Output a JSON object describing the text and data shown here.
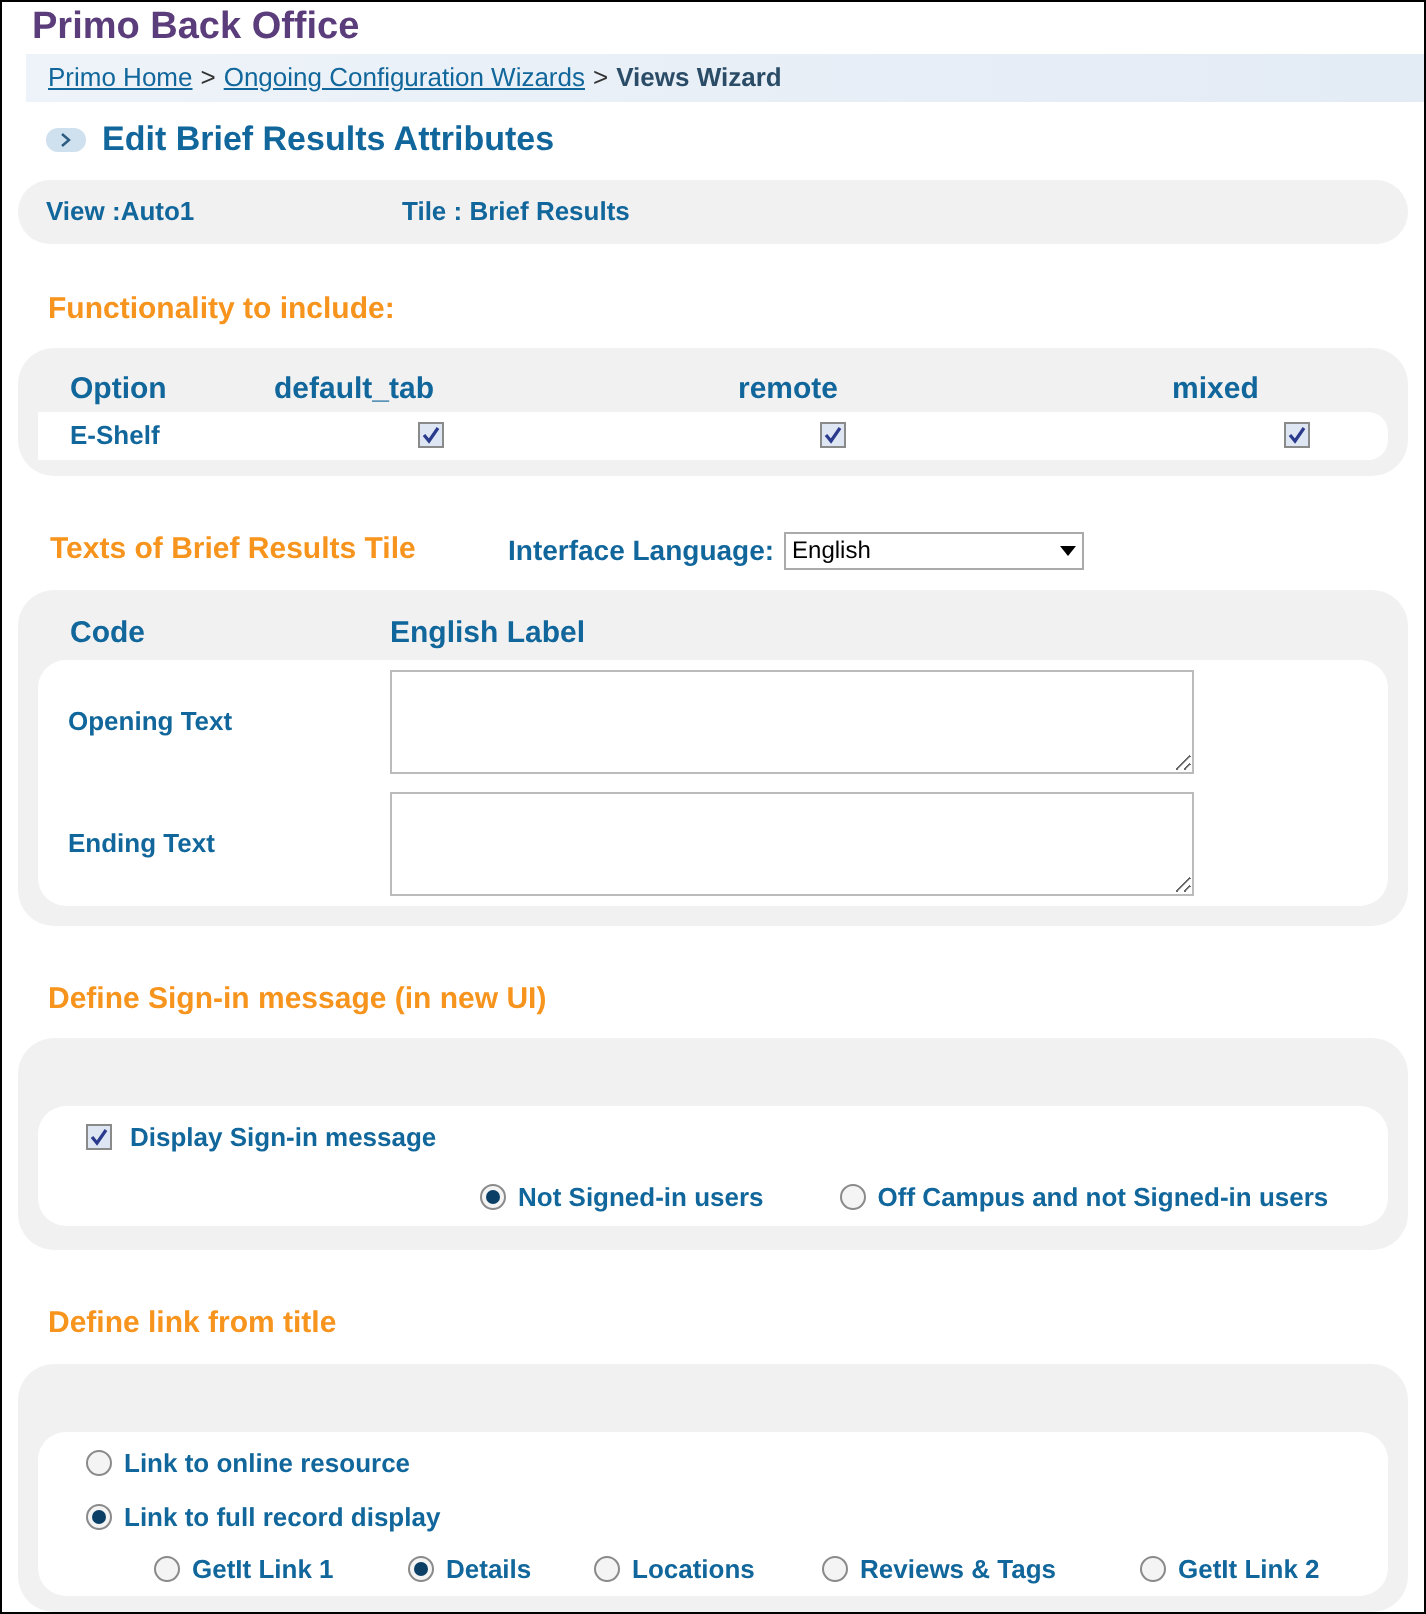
{
  "app_title": "Primo Back Office",
  "breadcrumb": {
    "separator": ">",
    "items": [
      {
        "label": "Primo Home",
        "kind": "link"
      },
      {
        "label": "Ongoing Configuration Wizards",
        "kind": "link"
      },
      {
        "label": "Views Wizard",
        "kind": "current"
      }
    ]
  },
  "page_heading": "Edit Brief Results Attributes",
  "view_info": [
    "View :Auto1",
    "Tile : Brief Results"
  ],
  "functionality": {
    "heading": "Functionality to include:",
    "columns": [
      "Option",
      "default_tab",
      "remote",
      "mixed"
    ],
    "rows": [
      {
        "option": "E-Shelf",
        "checks": [
          {
            "checked": true
          },
          {
            "checked": true
          },
          {
            "checked": true
          }
        ]
      }
    ]
  },
  "texts": {
    "heading": "Texts of Brief Results Tile",
    "language_label": "Interface Language:",
    "language_value": "English",
    "columns": [
      "Code",
      "English Label"
    ],
    "rows": [
      {
        "code": "Opening Text"
      },
      {
        "code": "Ending Text"
      }
    ]
  },
  "sign_in": {
    "heading": "Define Sign-in message (in new UI)",
    "checkbox": {
      "label": "Display Sign-in message",
      "checked": true
    },
    "options": [
      {
        "label": "Not Signed-in users",
        "selected": true
      },
      {
        "label": "Off Campus and not Signed-in users",
        "selected": false
      }
    ]
  },
  "link_from_title": {
    "heading": "Define link from title",
    "options": [
      {
        "label": "Link to online resource",
        "selected": false
      },
      {
        "label": "Link to full record display",
        "selected": true
      }
    ],
    "sub_options": [
      {
        "label": "GetIt Link 1",
        "selected": false
      },
      {
        "label": "Details",
        "selected": true
      },
      {
        "label": "Locations",
        "selected": false
      },
      {
        "label": "Reviews & Tags",
        "selected": false
      },
      {
        "label": "GetIt Link 2",
        "selected": false
      }
    ]
  }
}
